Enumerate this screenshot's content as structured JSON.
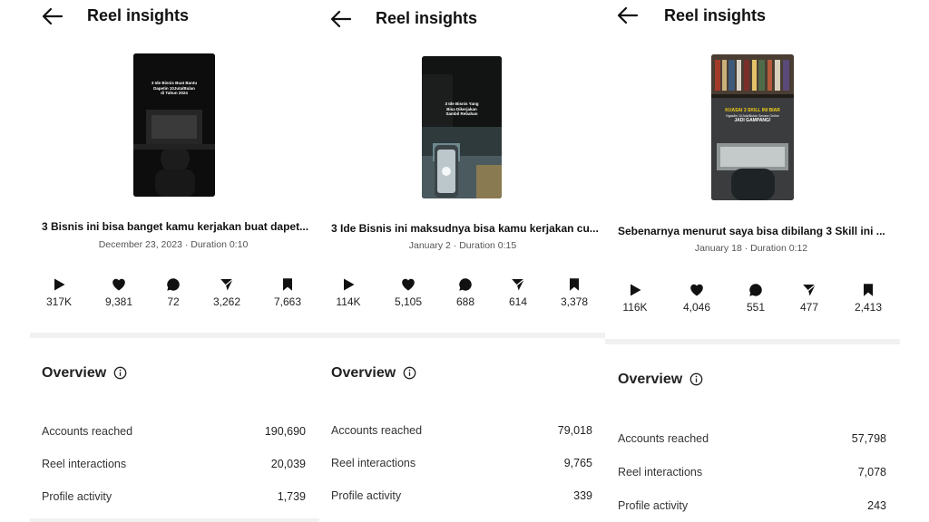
{
  "colors": {
    "text": "#111111",
    "muted": "#555555",
    "divider": "#f1f1f1",
    "yellow": "#f5d21a"
  },
  "icons": {
    "back": "arrow-left-icon",
    "plays": "play-icon",
    "likes": "heart-icon",
    "comments": "comment-icon",
    "shares": "send-icon",
    "saves": "bookmark-icon",
    "info": "info-icon"
  },
  "panels": [
    {
      "header": {
        "title": "Reel insights"
      },
      "thumbnail": {
        "text_lines": [
          "3 Ide Bisnis Buat Bantu",
          "Dapetin 10Juta/Bulan",
          "di Tahun 2024"
        ]
      },
      "caption": "3 Bisnis ini bisa banget kamu kerjakan buat dapet...",
      "meta": "December 23, 2023 · Duration 0:10",
      "stats": {
        "plays": "317K",
        "likes": "9,381",
        "comments": "72",
        "shares": "3,262",
        "saves": "7,663"
      },
      "overview": {
        "title": "Overview",
        "rows": [
          {
            "label": "Accounts reached",
            "value": "190,690"
          },
          {
            "label": "Reel interactions",
            "value": "20,039"
          },
          {
            "label": "Profile activity",
            "value": "1,739"
          }
        ]
      }
    },
    {
      "header": {
        "title": "Reel insights"
      },
      "thumbnail": {
        "text_lines": [
          "3 Ide Bisnis Yang",
          "Bisa Dikerjakan",
          "Sambil Rebahan"
        ]
      },
      "caption": "3 Ide Bisnis ini maksudnya bisa kamu kerjakan cu...",
      "meta": "January 2 · Duration 0:15",
      "stats": {
        "plays": "114K",
        "likes": "5,105",
        "comments": "688",
        "shares": "614",
        "saves": "3,378"
      },
      "overview": {
        "title": "Overview",
        "rows": [
          {
            "label": "Accounts reached",
            "value": "79,018"
          },
          {
            "label": "Reel interactions",
            "value": "9,765"
          },
          {
            "label": "Profile activity",
            "value": "339"
          }
        ]
      }
    },
    {
      "header": {
        "title": "Reel insights"
      },
      "thumbnail": {
        "text_lines": [
          "KUASAI 3 SKILL INI BIAR",
          "Ngasilin 10Juta/Bulan Secara Online",
          "JADI GAMPANG!"
        ]
      },
      "caption": "Sebenarnya menurut saya bisa dibilang 3 Skill ini ...",
      "meta": "January 18 · Duration 0:12",
      "stats": {
        "plays": "116K",
        "likes": "4,046",
        "comments": "551",
        "shares": "477",
        "saves": "2,413"
      },
      "overview": {
        "title": "Overview",
        "rows": [
          {
            "label": "Accounts reached",
            "value": "57,798"
          },
          {
            "label": "Reel interactions",
            "value": "7,078"
          },
          {
            "label": "Profile activity",
            "value": "243"
          }
        ]
      }
    }
  ]
}
